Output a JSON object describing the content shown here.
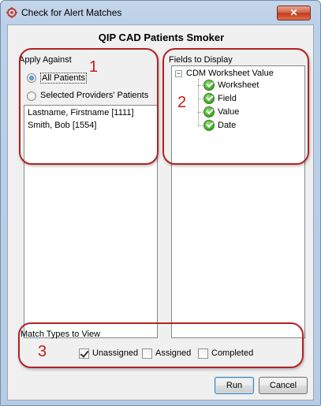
{
  "window": {
    "title": "Check for Alert Matches",
    "close_symbol": "✕"
  },
  "header": {
    "title": "QIP CAD Patients Smoker"
  },
  "apply_against": {
    "label": "Apply Against",
    "options": [
      {
        "label": "All Patients",
        "selected": true
      },
      {
        "label": "Selected Providers' Patients",
        "selected": false
      }
    ],
    "patients": [
      "Lastname, Firstname [1111]",
      "Smith, Bob [1554]"
    ]
  },
  "fields_to_display": {
    "label": "Fields to Display",
    "root": {
      "toggle": "−",
      "label": "CDM Worksheet Value"
    },
    "children": [
      "Worksheet",
      "Field",
      "Value",
      "Date"
    ],
    "child_icon": "green-check-icon"
  },
  "match_types": {
    "label": "Match Types to View",
    "options": [
      {
        "label": "Unassigned",
        "checked": true
      },
      {
        "label": "Assigned",
        "checked": false
      },
      {
        "label": "Completed",
        "checked": false
      }
    ]
  },
  "buttons": {
    "run": "Run",
    "cancel": "Cancel"
  },
  "annotations": [
    "1",
    "2",
    "3"
  ],
  "colors": {
    "annotation": "#b22222",
    "window_frame": "#bcd0e8",
    "close_button": "#c1391b"
  }
}
